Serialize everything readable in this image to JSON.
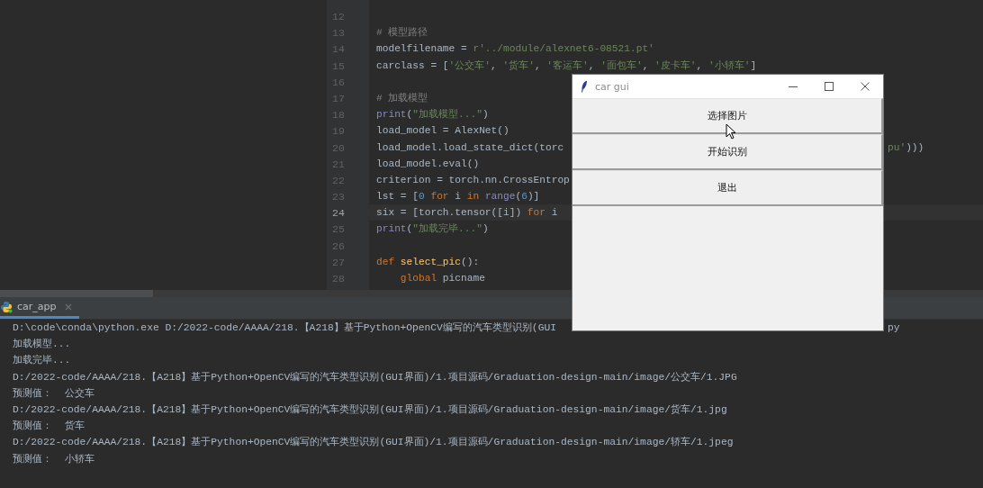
{
  "editor": {
    "lines": [
      {
        "number": "12",
        "current": false
      },
      {
        "number": "13",
        "current": false,
        "tokens": [
          {
            "kind": "comment",
            "text": "# 模型路径"
          }
        ]
      },
      {
        "number": "14",
        "current": false,
        "tokens": [
          {
            "kind": "plain",
            "text": "modelfilename = "
          },
          {
            "kind": "string",
            "text": "r'../module/alexnet6-08521.pt'"
          }
        ]
      },
      {
        "number": "15",
        "current": false,
        "tokens": [
          {
            "kind": "plain",
            "text": "carclass = ["
          },
          {
            "kind": "string",
            "text": "'公交车'"
          },
          {
            "kind": "plain",
            "text": ", "
          },
          {
            "kind": "string",
            "text": "'货车'"
          },
          {
            "kind": "plain",
            "text": ", "
          },
          {
            "kind": "string",
            "text": "'客运车'"
          },
          {
            "kind": "plain",
            "text": ", "
          },
          {
            "kind": "string",
            "text": "'面包车'"
          },
          {
            "kind": "plain",
            "text": ", "
          },
          {
            "kind": "string",
            "text": "'皮卡车'"
          },
          {
            "kind": "plain",
            "text": ", "
          },
          {
            "kind": "string",
            "text": "'小轿车'"
          },
          {
            "kind": "plain",
            "text": "]"
          }
        ]
      },
      {
        "number": "16",
        "current": false
      },
      {
        "number": "17",
        "current": false,
        "tokens": [
          {
            "kind": "comment",
            "text": "# 加载模型"
          }
        ]
      },
      {
        "number": "18",
        "current": false,
        "tokens": [
          {
            "kind": "builtin",
            "text": "print"
          },
          {
            "kind": "plain",
            "text": "("
          },
          {
            "kind": "string",
            "text": "\"加载模型...\""
          },
          {
            "kind": "plain",
            "text": ")"
          }
        ]
      },
      {
        "number": "19",
        "current": false,
        "tokens": [
          {
            "kind": "plain",
            "text": "load_model = AlexNet()"
          }
        ]
      },
      {
        "number": "20",
        "current": false,
        "tokens": [
          {
            "kind": "plain",
            "text": "load_model.load_state_dict(torc"
          }
        ],
        "tail": [
          {
            "kind": "string",
            "text": "pu'"
          },
          {
            "kind": "plain",
            "text": ")))"
          }
        ]
      },
      {
        "number": "21",
        "current": false,
        "tokens": [
          {
            "kind": "plain",
            "text": "load_model.eval()"
          }
        ]
      },
      {
        "number": "22",
        "current": false,
        "tokens": [
          {
            "kind": "plain",
            "text": "criterion = torch.nn.CrossEntrop"
          }
        ]
      },
      {
        "number": "23",
        "current": false,
        "tokens": [
          {
            "kind": "plain",
            "text": "lst = ["
          },
          {
            "kind": "number",
            "text": "0"
          },
          {
            "kind": "keyword",
            "text": " for "
          },
          {
            "kind": "plain",
            "text": "i "
          },
          {
            "kind": "keyword",
            "text": "in "
          },
          {
            "kind": "builtin",
            "text": "range"
          },
          {
            "kind": "plain",
            "text": "("
          },
          {
            "kind": "number",
            "text": "6"
          },
          {
            "kind": "plain",
            "text": ")]"
          }
        ]
      },
      {
        "number": "24",
        "current": true,
        "tokens": [
          {
            "kind": "plain",
            "text": "six = [torch.tensor([i]) "
          },
          {
            "kind": "keyword",
            "text": "for"
          },
          {
            "kind": "plain",
            "text": " i"
          }
        ]
      },
      {
        "number": "25",
        "current": false,
        "tokens": [
          {
            "kind": "builtin",
            "text": "print"
          },
          {
            "kind": "plain",
            "text": "("
          },
          {
            "kind": "string",
            "text": "\"加载完毕...\""
          },
          {
            "kind": "plain",
            "text": ")"
          }
        ]
      },
      {
        "number": "26",
        "current": false
      },
      {
        "number": "27",
        "current": false,
        "tokens": [
          {
            "kind": "keyword",
            "text": "def "
          },
          {
            "kind": "funcdef",
            "text": "select_pic"
          },
          {
            "kind": "plain",
            "text": "():"
          }
        ]
      },
      {
        "number": "28",
        "current": false,
        "tokens": [
          {
            "kind": "keyword",
            "text": "    global"
          },
          {
            "kind": "plain",
            "text": " picname"
          }
        ]
      }
    ]
  },
  "run_panel": {
    "tabs": [
      {
        "label": "car_app",
        "selected": true
      }
    ],
    "lines": [
      {
        "text": "D:\\code\\conda\\python.exe D:/2022-code/AAAA/218.【A218】基于Python+OpenCV编写的汽车类型识别(GUI",
        "tail": "py"
      },
      {
        "text": "加载模型..."
      },
      {
        "text": "加载完毕..."
      },
      {
        "text": "D:/2022-code/AAAA/218.【A218】基于Python+OpenCV编写的汽车类型识别(GUI界面)/1.项目源码/Graduation-design-main/image/公交车/1.JPG"
      },
      {
        "text": "预测值：  公交车"
      },
      {
        "text": "D:/2022-code/AAAA/218.【A218】基于Python+OpenCV编写的汽车类型识别(GUI界面)/1.项目源码/Graduation-design-main/image/货车/1.jpg"
      },
      {
        "text": "预测值：  货车"
      },
      {
        "text": "D:/2022-code/AAAA/218.【A218】基于Python+OpenCV编写的汽车类型识别(GUI界面)/1.项目源码/Graduation-design-main/image/轿车/1.jpeg"
      },
      {
        "text": "预测值：  小轿车"
      }
    ]
  },
  "app_window": {
    "title": "car gui",
    "buttons": [
      "选择图片",
      "开始识别",
      "退出"
    ]
  }
}
